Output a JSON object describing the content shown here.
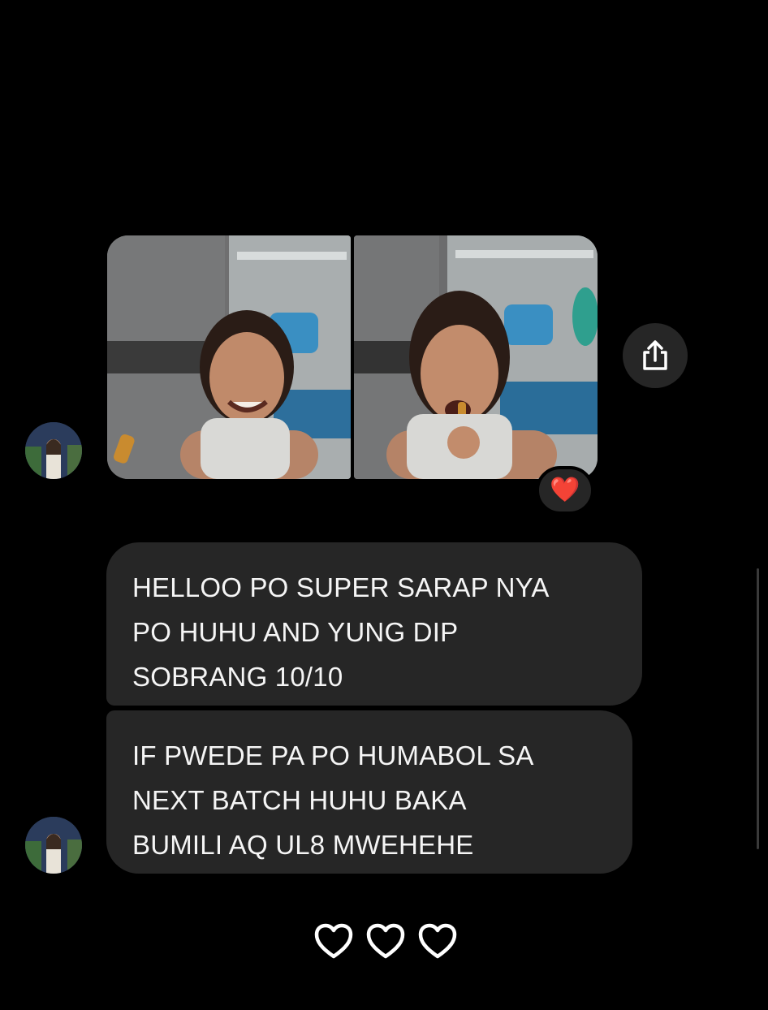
{
  "thread": {
    "photos": [
      {
        "icon": "photo-girl-smiling"
      },
      {
        "icon": "photo-girl-eating-snack"
      }
    ],
    "photo_reaction": "❤️",
    "share_icon": "share-icon",
    "messages": [
      {
        "lines": [
          "HELLOO PO SUPER SARAP NYA",
          "PO HUHU AND YUNG DIP",
          "SOBRANG 10/10"
        ]
      },
      {
        "lines": [
          "IF PWEDE PA PO HUMABOL SA",
          "NEXT BATCH HUHU BAKA",
          "BUMILI AQ UL8 MWEHEHE"
        ]
      }
    ],
    "trailing_hearts": [
      "heart-outline-icon",
      "heart-outline-icon",
      "heart-outline-icon"
    ]
  },
  "colors": {
    "background": "#000000",
    "bubble": "#262626",
    "text": "#f5f5f5",
    "reaction_heart": "#e0242b"
  }
}
